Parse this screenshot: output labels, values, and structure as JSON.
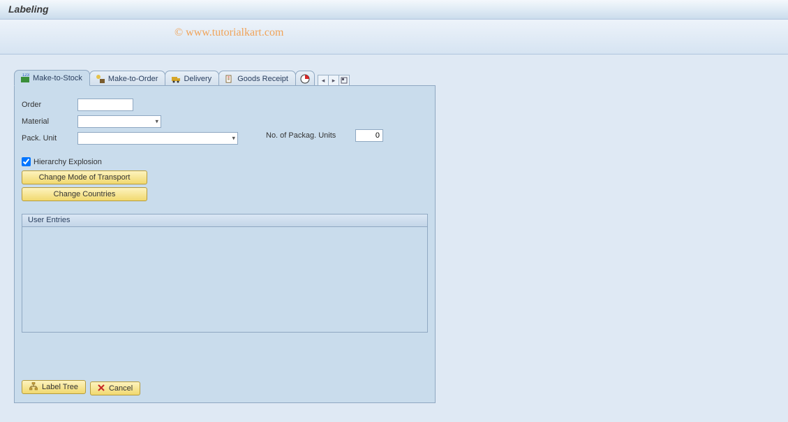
{
  "header": {
    "title": "Labeling"
  },
  "watermark": "© www.tutorialkart.com",
  "tabs": [
    {
      "label": "Make-to-Stock"
    },
    {
      "label": "Make-to-Order"
    },
    {
      "label": "Delivery"
    },
    {
      "label": "Goods Receipt"
    }
  ],
  "form": {
    "order_label": "Order",
    "order_value": "",
    "material_label": "Material",
    "material_value": "",
    "packunit_label": "Pack. Unit",
    "packunit_value": "",
    "num_packag_label": "No. of Packag. Units",
    "num_packag_value": "0",
    "hierarchy_label": "Hierarchy Explosion",
    "change_transport_btn": "Change Mode of Transport",
    "change_countries_btn": "Change Countries",
    "groupbox_title": "User Entries",
    "label_tree_btn": "Label Tree",
    "cancel_btn": "Cancel"
  }
}
